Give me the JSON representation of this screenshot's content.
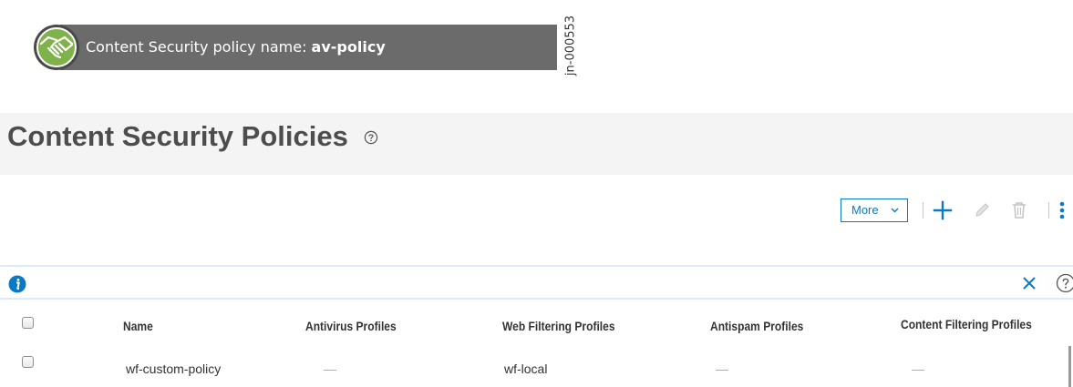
{
  "callout": {
    "label": "Content Security policy name: ",
    "value": "av-policy",
    "icon": "handshake-icon",
    "colors": {
      "bar": "#6b6b6b",
      "icon_bg": "#7fb24a"
    }
  },
  "doc_id": "jn-000553",
  "page": {
    "title": "Content Security Policies",
    "title_help_icon": "question-circle-icon"
  },
  "toolbar": {
    "more_label": "More",
    "icons": [
      "add-icon",
      "edit-icon",
      "delete-icon",
      "more-vertical-icon"
    ],
    "accent": "#0a7ac6"
  },
  "infobar": {
    "icons": [
      "info-icon",
      "close-icon",
      "help-icon"
    ]
  },
  "table": {
    "columns": [
      "Name",
      "Antivirus Profiles",
      "Web Filtering Profiles",
      "Antispam Profiles",
      "Content Filtering Profiles"
    ],
    "rows": [
      {
        "name": "wf-custom-policy",
        "antivirus": "—",
        "web_filtering": "wf-local",
        "antispam": "—",
        "content_filtering": "—"
      }
    ]
  }
}
